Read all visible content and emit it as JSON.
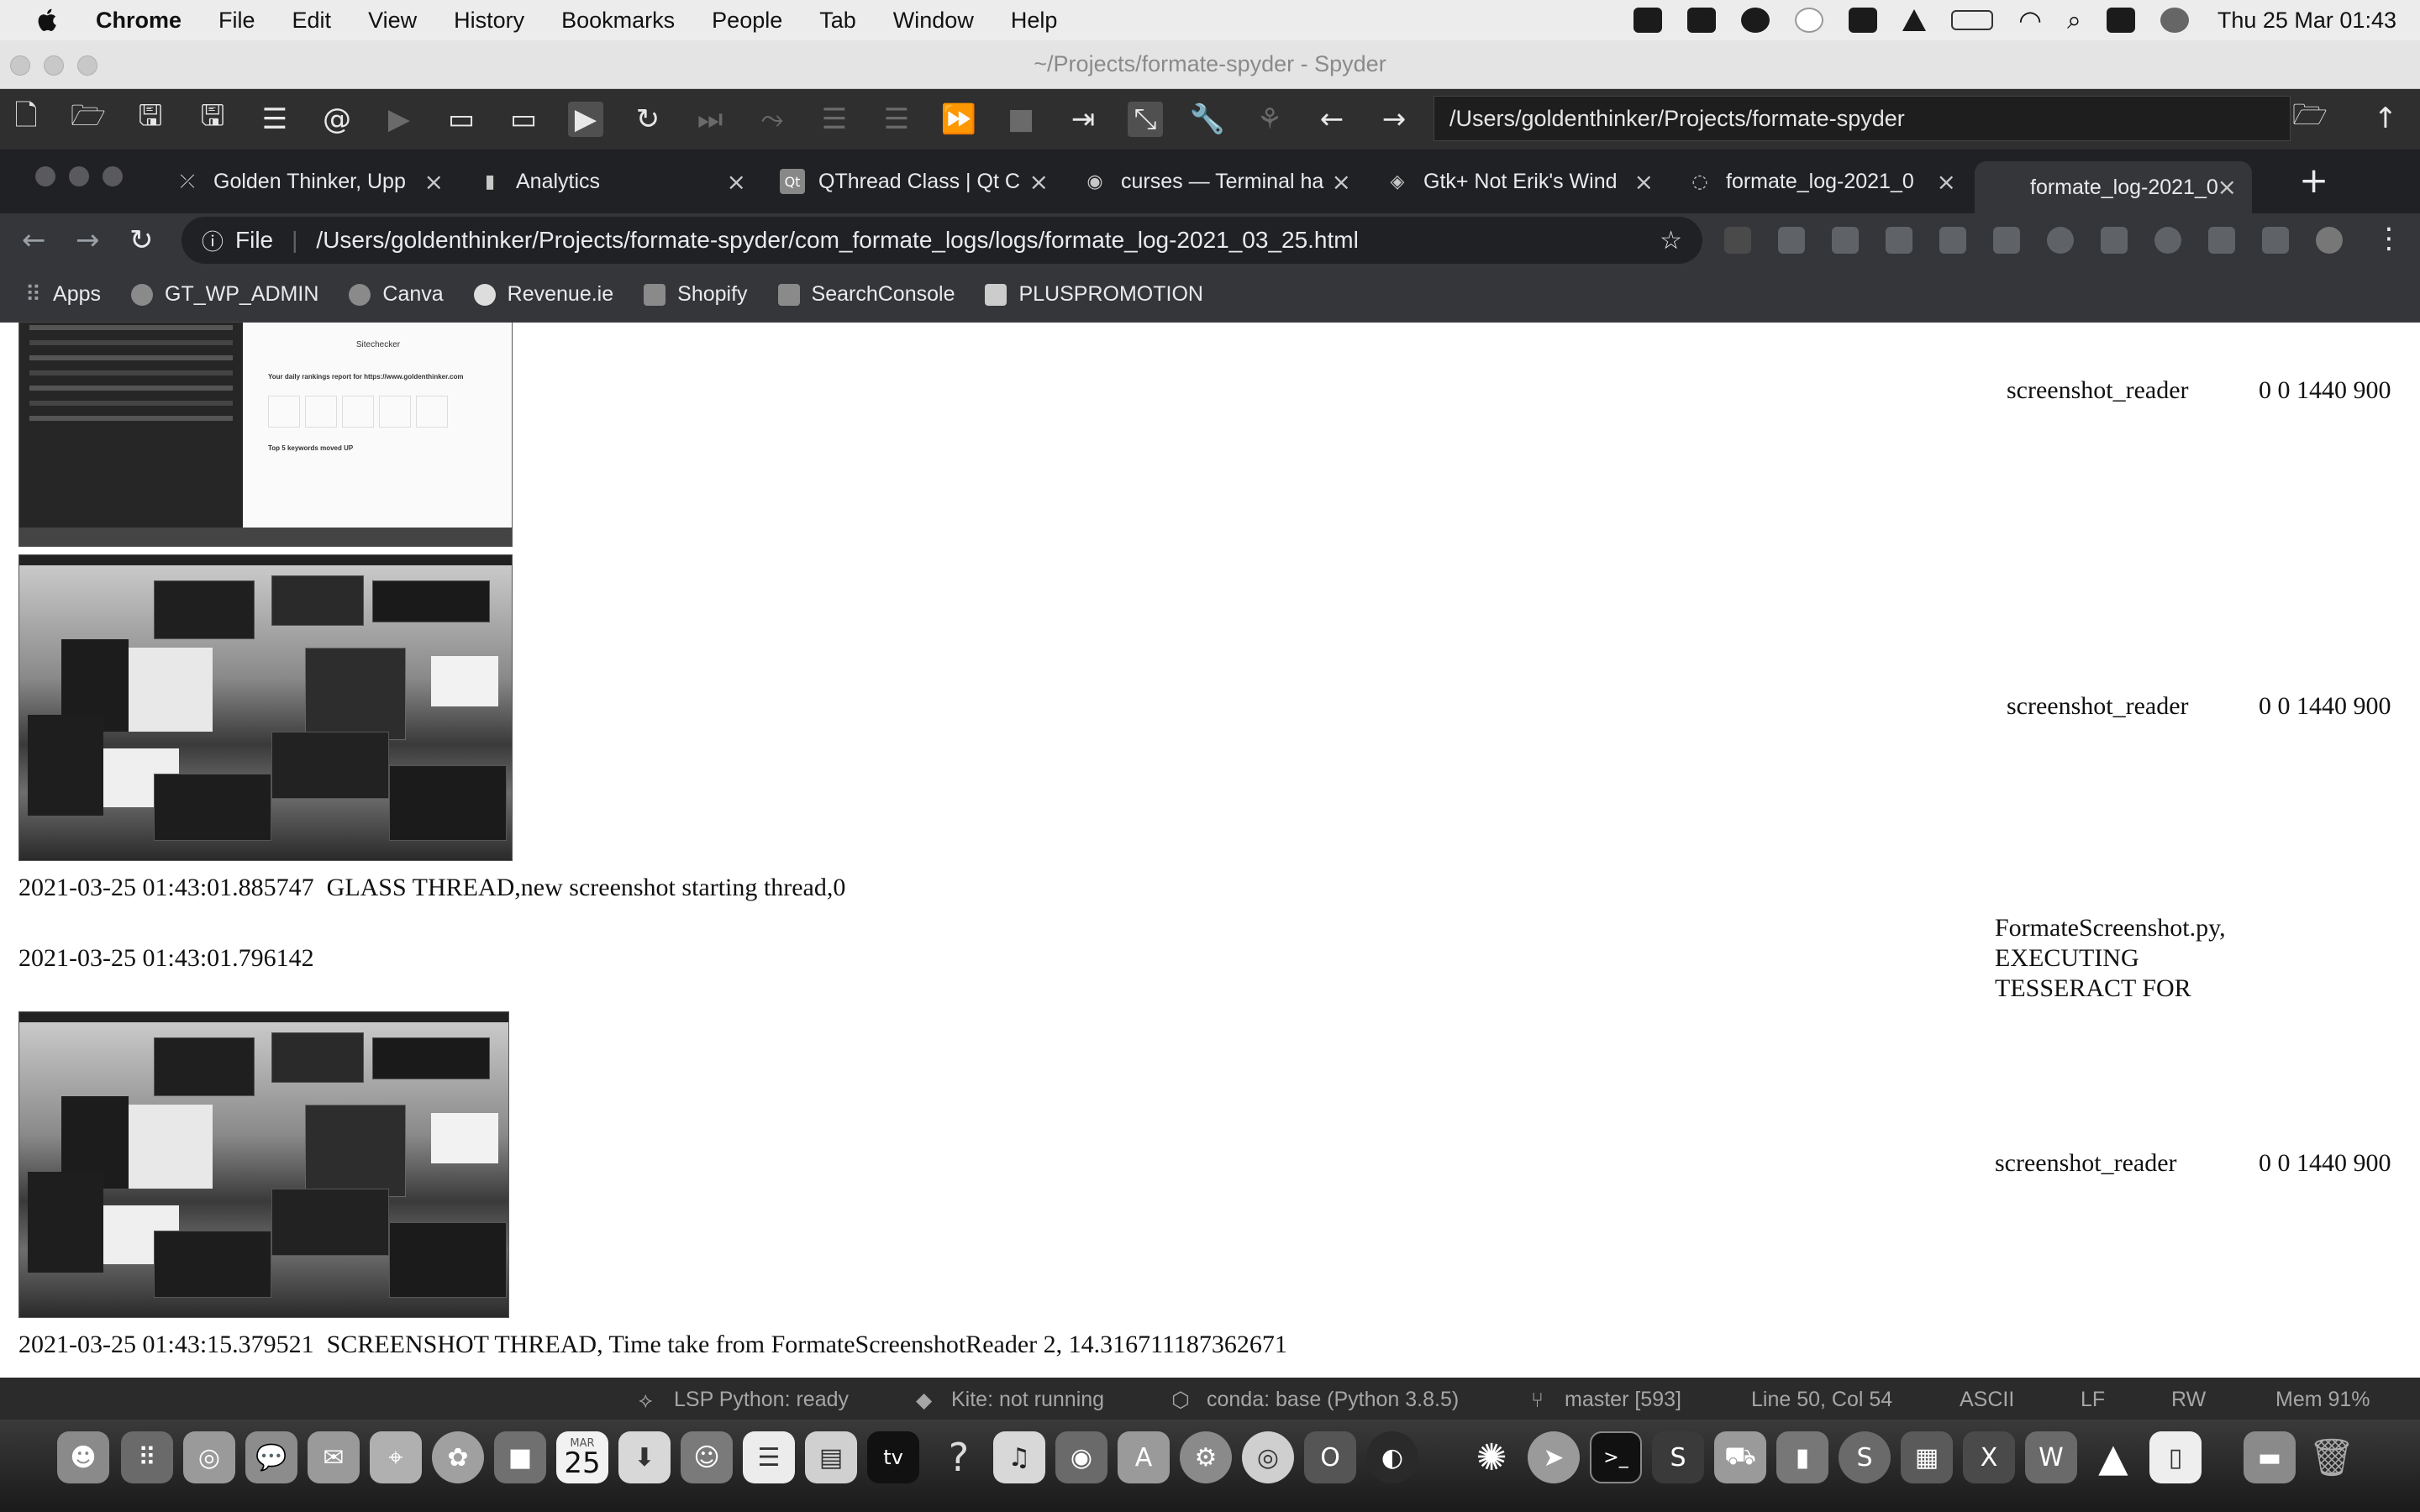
{
  "menubar": {
    "app": "Chrome",
    "items": [
      "File",
      "Edit",
      "View",
      "History",
      "Bookmarks",
      "People",
      "Tab",
      "Window",
      "Help"
    ],
    "clock": "Thu 25 Mar  01:43"
  },
  "spyder": {
    "title": "~/Projects/formate-spyder - Spyder",
    "path": "/Users/goldenthinker/Projects/formate-spyder"
  },
  "chrome": {
    "tabs": [
      {
        "label": "Golden Thinker, Upp",
        "icon": "⤫"
      },
      {
        "label": "Analytics",
        "icon": "▮"
      },
      {
        "label": "QThread Class | Qt C",
        "icon": "Qt"
      },
      {
        "label": "curses — Terminal ha",
        "icon": "◉"
      },
      {
        "label": "Gtk+ Not Erik's Wind",
        "icon": "◈"
      },
      {
        "label": "formate_log-2021_0",
        "icon": "◌"
      },
      {
        "label": "formate_log-2021_0",
        "icon": ""
      }
    ],
    "new_tab": "+",
    "url_scheme": "File",
    "url": "/Users/goldenthinker/Projects/formate-spyder/com_formate_logs/logs/formate_log-2021_03_25.html",
    "bookmarks": [
      "Apps",
      "GT_WP_ADMIN",
      "Canva",
      "Revenue.ie",
      "Shopify",
      "SearchConsole",
      "PLUSPROMOTION"
    ]
  },
  "log": {
    "rows": [
      {
        "source": "screenshot_reader",
        "rect": "0 0 1440 900"
      },
      {
        "source": "screenshot_reader",
        "rect": "0 0 1440 900"
      },
      {
        "line": "2021-03-25 01:43:01.885747  GLASS THREAD,new screenshot starting thread,0"
      },
      {
        "line": "2021-03-25 01:43:01.796142",
        "note": [
          "FormateScreenshot.py,",
          "EXECUTING",
          "TESSERACT FOR"
        ]
      },
      {
        "source": "screenshot_reader",
        "rect": "0 0 1440 900"
      },
      {
        "line": "2021-03-25 01:43:15.379521  SCREENSHOT THREAD, Time take from FormateScreenshotReader 2, 14.316711187362671"
      }
    ],
    "shot1_text": {
      "title": "Sitechecker",
      "report": "Your daily rankings report for https://www.goldenthinker.com",
      "keywords": "Top 5 keywords moved UP"
    }
  },
  "statusbar": {
    "lsp": "LSP Python: ready",
    "kite": "Kite: not running",
    "conda": "conda: base (Python 3.8.5)",
    "git": "master [593]",
    "position": "Line 50, Col 54",
    "encoding": "ASCII",
    "eol": "LF",
    "rw": "RW",
    "mem": "Mem 91%"
  },
  "dock": {
    "calendar_month": "MAR",
    "calendar_day": "25",
    "tv_label": "tv",
    "help_glyph": "?"
  }
}
